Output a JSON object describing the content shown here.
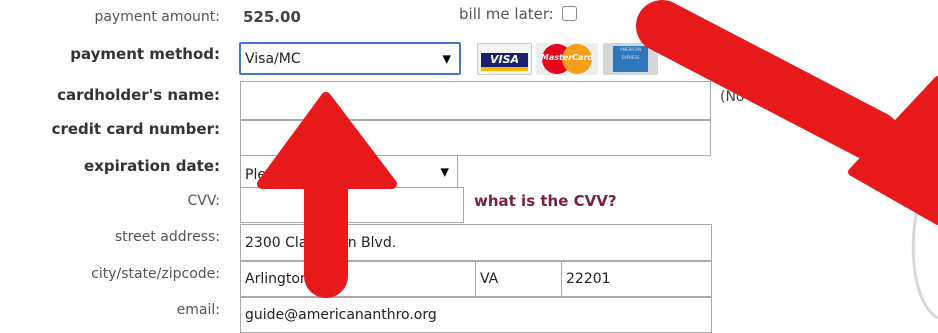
{
  "payment_amount": {
    "label": "payment amount:",
    "value": "525.00"
  },
  "bill_me_later": {
    "label": "bill me later:"
  },
  "payment_method": {
    "label": "payment method:",
    "selected": "Visa/MC",
    "cards": {
      "visa": "VISA",
      "mastercard": "MasterCard",
      "amex": "AMERICAN EXPRESS"
    }
  },
  "cardholder_name": {
    "label": "cardholder's name:",
    "value": ""
  },
  "card_number": {
    "label": "credit card number:",
    "value": ""
  },
  "note": "(No sp                   des)",
  "expiration_date": {
    "label": "expiration date:",
    "selected": "Please select"
  },
  "cvv": {
    "label": "CVV:",
    "value": "",
    "help_link": "what is the CVV?"
  },
  "street_address": {
    "label": "street address:",
    "value": "2300 Clarendon Blvd."
  },
  "city_state_zip": {
    "label": "city/state/zipcode:",
    "city": "Arlington",
    "state": "VA",
    "zip": "22201"
  },
  "email": {
    "label": "email:",
    "value": "guide@americananthro.org"
  },
  "colors": {
    "arrow": "#e8191a",
    "link": "#7a1f43",
    "border": "#a9a9a9"
  }
}
